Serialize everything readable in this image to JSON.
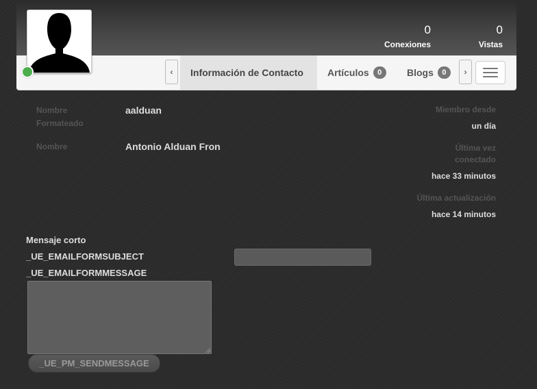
{
  "header": {
    "stats": [
      {
        "value": "0",
        "label": "Conexiones"
      },
      {
        "value": "0",
        "label": "Vistas"
      }
    ]
  },
  "nav": {
    "scroll_left": "‹",
    "scroll_right": "›",
    "tabs": [
      {
        "label": "Información de Contacto",
        "active": true
      },
      {
        "label": "Artículos",
        "badge": "0"
      },
      {
        "label": "Blogs",
        "badge": "0"
      }
    ]
  },
  "fields": {
    "formatted_name_label": "Nombre Formateado",
    "formatted_name_value": "aalduan",
    "name_label": "Nombre",
    "name_value": "Antonio Alduan Fron"
  },
  "side": {
    "member_since_label": "Miembro desde",
    "member_since_value": "un día",
    "last_online_label": "Última vez conectado",
    "last_online_value": "hace 33 minutos",
    "last_update_label": "Última actualización",
    "last_update_value": "hace 14 minutos"
  },
  "message": {
    "short_label": "Mensaje corto",
    "subject_label": "_UE_EMAILFORMSUBJECT",
    "subject_value": "",
    "message_label": "_UE_EMAILFORMMESSAGE",
    "message_value": "",
    "send_label": "_UE_PM_SENDMESSAGE"
  },
  "colors": {
    "online": "#4cae4c",
    "badge": "#777777",
    "active_tab": "#e3e3e3"
  }
}
